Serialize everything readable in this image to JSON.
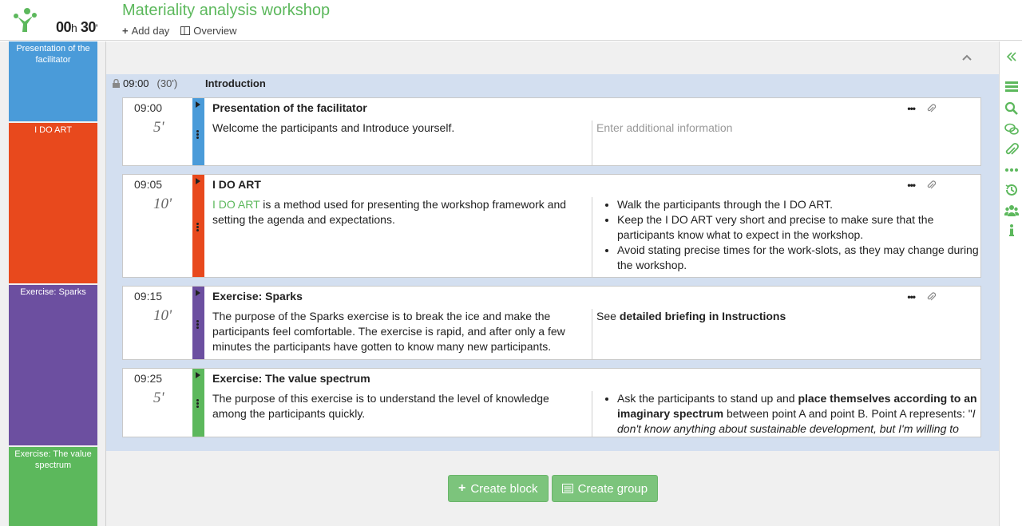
{
  "header": {
    "timer_hours": "00",
    "timer_h_unit": "h",
    "timer_minutes": "30",
    "timer_min_unit": "'",
    "title": "Materiality analysis workshop",
    "add_day_label": "Add day",
    "overview_label": "Overview"
  },
  "sidebar": {
    "items": [
      {
        "label": "Presentation of the facilitator",
        "color": "#4a9bd9"
      },
      {
        "label": "I DO ART",
        "color": "#e8491d"
      },
      {
        "label": "Exercise: Sparks",
        "color": "#6c4fa0"
      },
      {
        "label": "Exercise: The value spectrum",
        "color": "#5cb85c"
      }
    ]
  },
  "group": {
    "start_time": "09:00",
    "duration": "(30')",
    "name": "Introduction"
  },
  "blocks": [
    {
      "time": "09:00",
      "duration": "5'",
      "color": "#4a9bd9",
      "title": "Presentation of the facilitator",
      "description": "Welcome the participants and Introduce yourself.",
      "info_placeholder": "Enter additional information"
    },
    {
      "time": "09:05",
      "duration": "10'",
      "color": "#e8491d",
      "title": "I DO ART",
      "description_link": "I DO ART",
      "description_rest": " is a method used for presenting the workshop framework and setting the agenda and expectations.",
      "info_items": [
        "Walk the participants through the I DO ART.",
        "Keep the I DO ART very short and precise to make sure that the participants know what to expect in the workshop.",
        "Avoid stating precise times for the work-slots, as they may change during the workshop."
      ]
    },
    {
      "time": "09:15",
      "duration": "10'",
      "color": "#6c4fa0",
      "title": "Exercise: Sparks",
      "description": "The purpose of the Sparks exercise is to break the ice and make the participants feel comfortable. The exercise is rapid, and after only a few minutes the participants have gotten to know many new participants.",
      "info_prefix": "See ",
      "info_bold": "detailed briefing in Instructions"
    },
    {
      "time": "09:25",
      "duration": "5'",
      "color": "#5cb85c",
      "title": "Exercise: The value spectrum",
      "description": "The purpose of this exercise is to understand the level of knowledge among the participants quickly.",
      "info_part1": "Ask the participants to stand up and ",
      "info_bold": "place themselves according to an imaginary spectrum",
      "info_part2": " between point A and point B. Point A represents: \"",
      "info_italic": "I don't know anything about sustainable development, but I'm willing to"
    }
  ],
  "footer": {
    "create_block_label": "Create block",
    "create_group_label": "Create group"
  },
  "right_bar": {
    "icons": [
      "collapse-icon",
      "list-icon",
      "search-icon",
      "comments-icon",
      "attachment-icon",
      "more-icon",
      "history-icon",
      "users-icon",
      "info-icon"
    ]
  },
  "colors": {
    "accent": "#5cb85c"
  }
}
